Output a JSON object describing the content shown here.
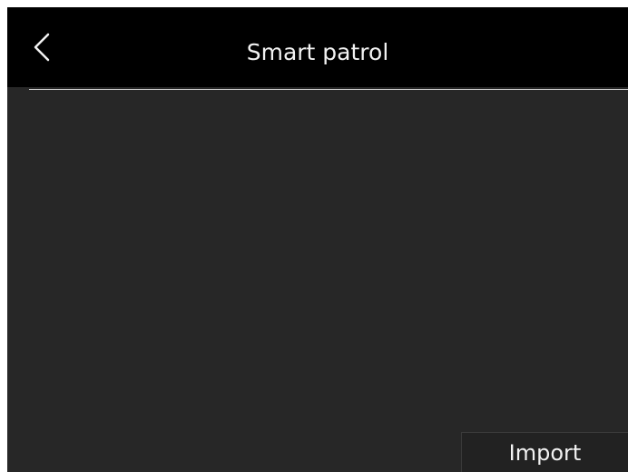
{
  "header": {
    "title": "Smart patrol",
    "back_icon": "chevron-left-icon"
  },
  "footer": {
    "import_label": "Import"
  },
  "colors": {
    "header_bg": "#000000",
    "screen_bg": "#272727",
    "text": "#f2f2f2",
    "divider": "#d8d8d8"
  }
}
